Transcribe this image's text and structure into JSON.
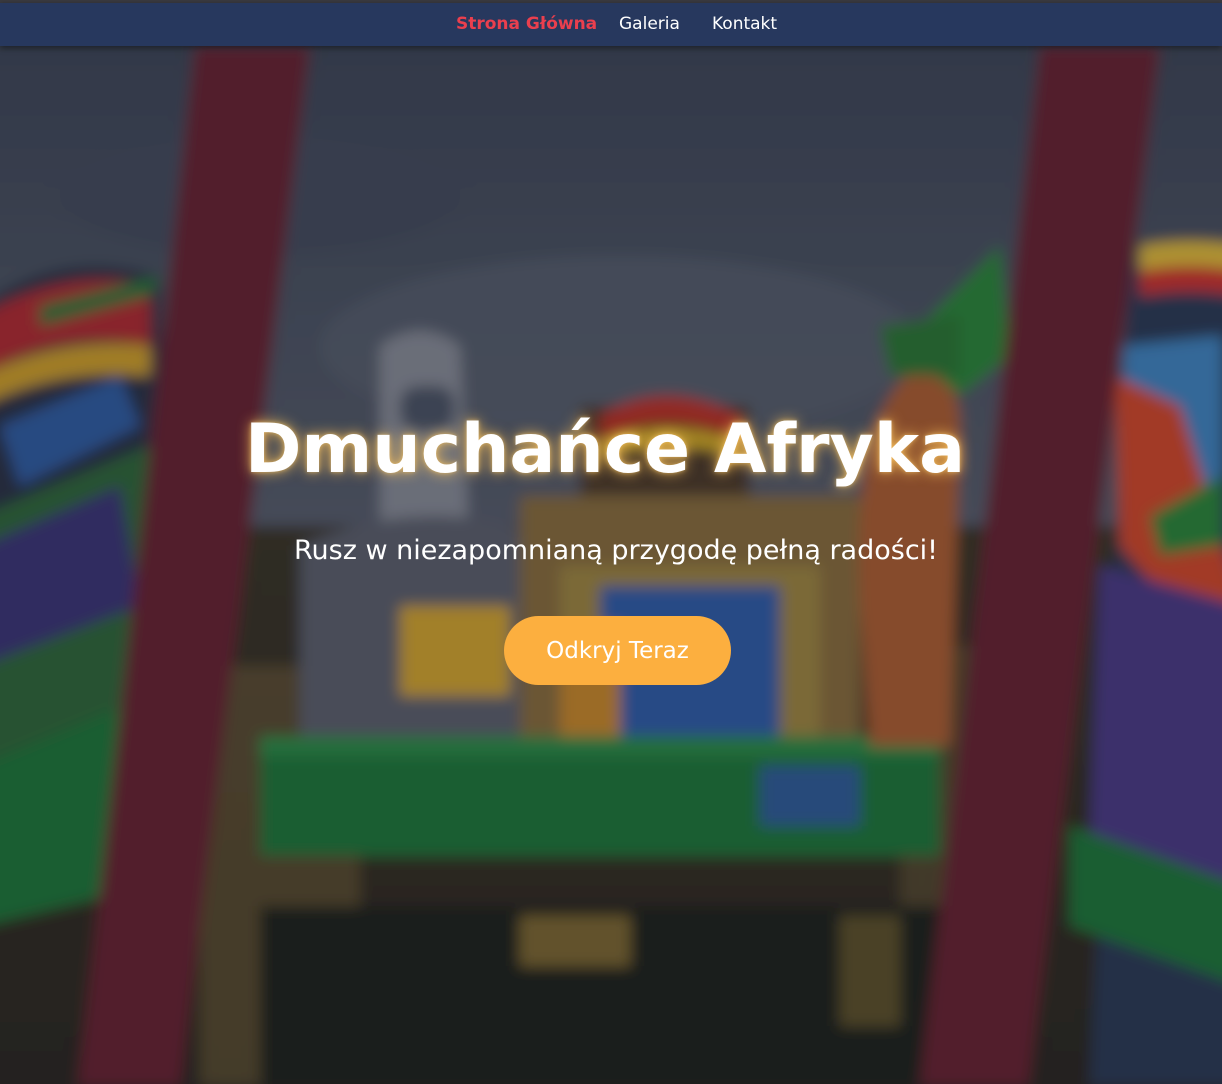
{
  "nav": {
    "items": [
      {
        "label": "Strona Główna",
        "active": true
      },
      {
        "label": "Galeria",
        "active": false
      },
      {
        "label": "Kontakt",
        "active": false
      }
    ]
  },
  "hero": {
    "title": "Dmuchańce Afryka",
    "subtitle": "Rusz w niezapomnianą przygodę pełną radości!",
    "cta_label": "Odkryj Teraz"
  },
  "colors": {
    "navbar": "#27385e",
    "nav_active": "#ea3f4e",
    "nav_text": "#ffffff",
    "cta": "#fcaf3f",
    "title_glow": "#ffc45a"
  }
}
